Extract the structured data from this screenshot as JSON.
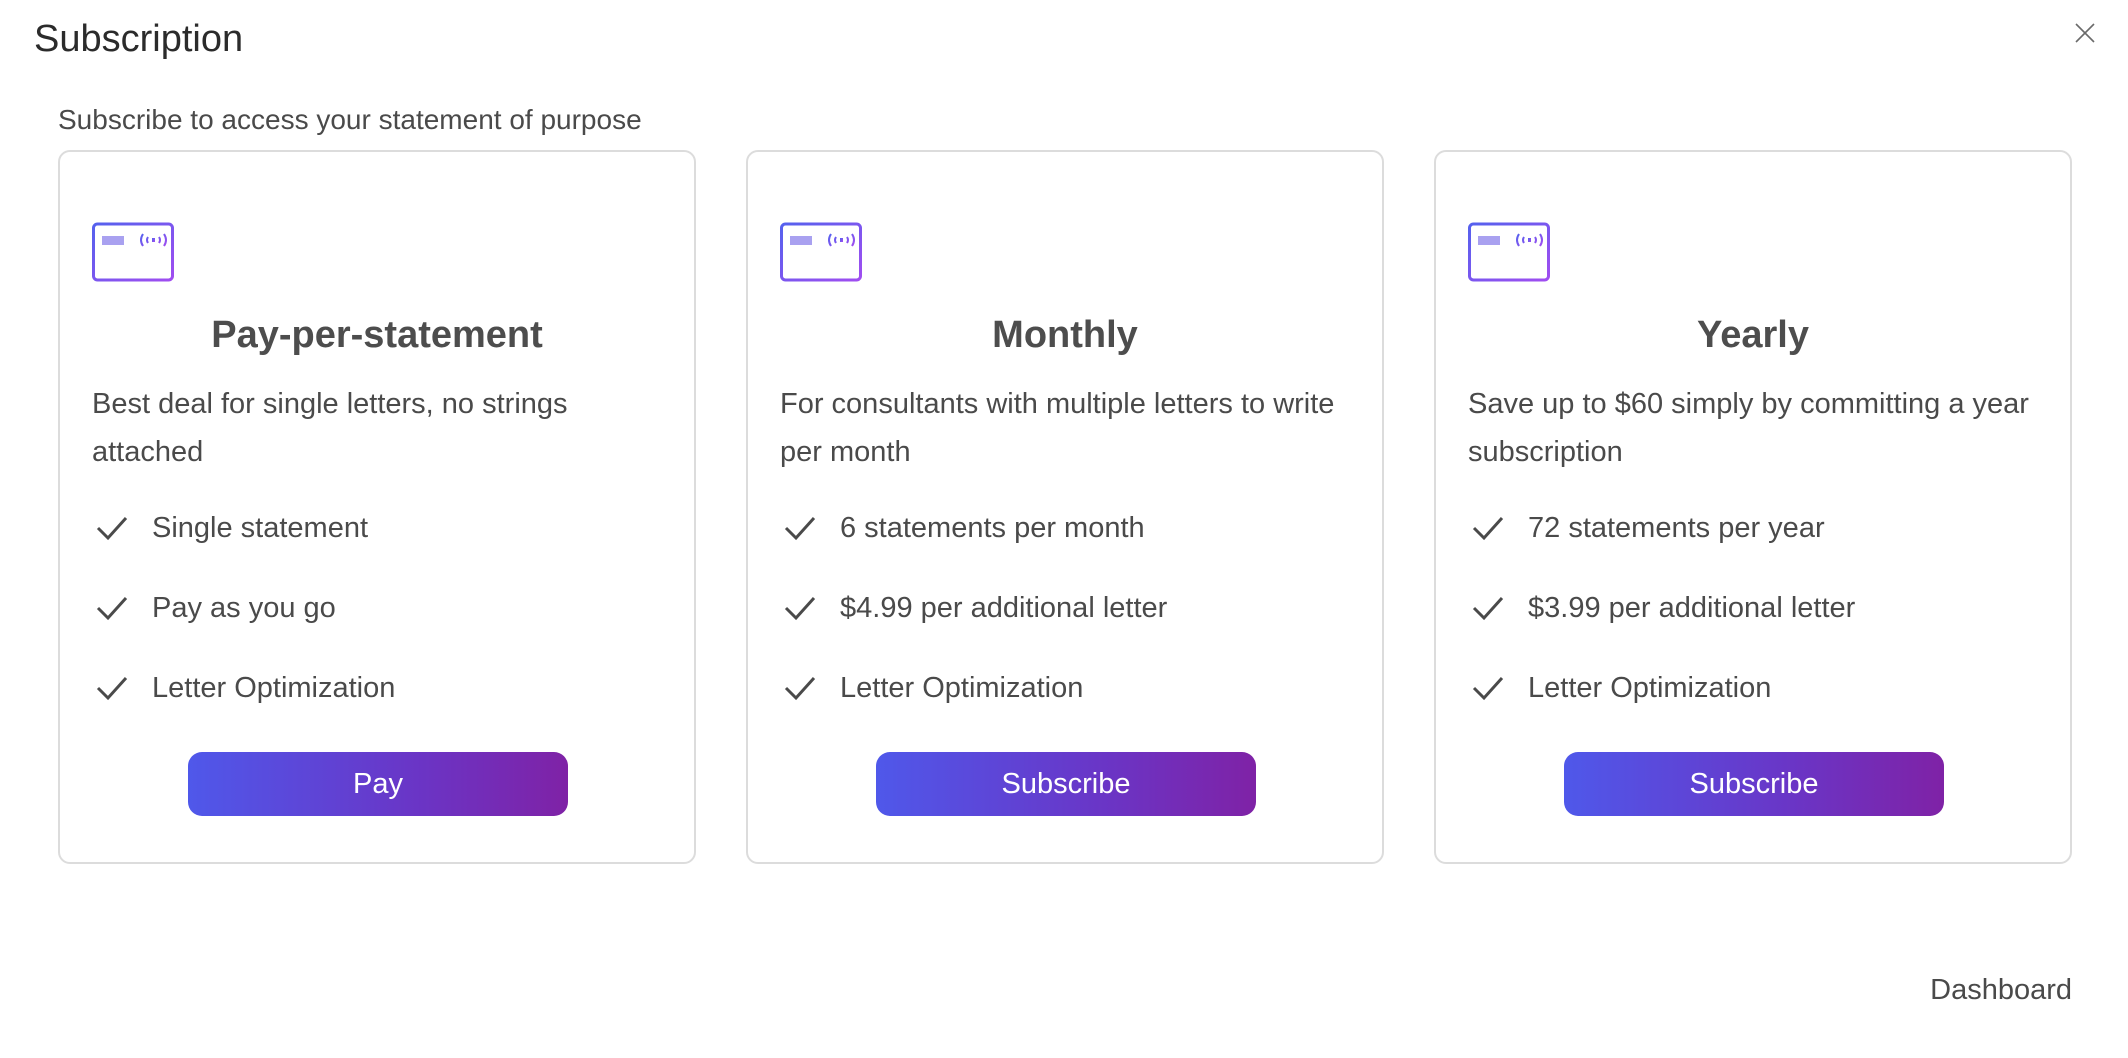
{
  "modal": {
    "title": "Subscription",
    "subtitle": "Subscribe to access your statement of purpose"
  },
  "plans": [
    {
      "title": "Pay-per-statement",
      "description": "Best deal for single letters, no strings attached",
      "features": [
        "Single statement",
        "Pay as you go",
        "Letter Optimization"
      ],
      "button_label": "Pay",
      "icon": "payment-card-icon"
    },
    {
      "title": "Monthly",
      "description": "For consultants with multiple letters to write per month",
      "features": [
        "6 statements per month",
        "$4.99 per additional letter",
        "Letter Optimization"
      ],
      "button_label": "Subscribe",
      "icon": "payment-card-icon"
    },
    {
      "title": "Yearly",
      "description": "Save up to $60 simply by committing a year subscription",
      "features": [
        "72 statements per year",
        "$3.99 per additional letter",
        "Letter Optimization"
      ],
      "button_label": "Subscribe",
      "icon": "payment-card-icon"
    }
  ],
  "footer": {
    "dashboard_label": "Dashboard"
  },
  "colors": {
    "gradient_start": "#4f58ea",
    "gradient_end": "#7f22a6",
    "icon_blue": "#5561ee",
    "icon_purple": "#a04df0"
  }
}
